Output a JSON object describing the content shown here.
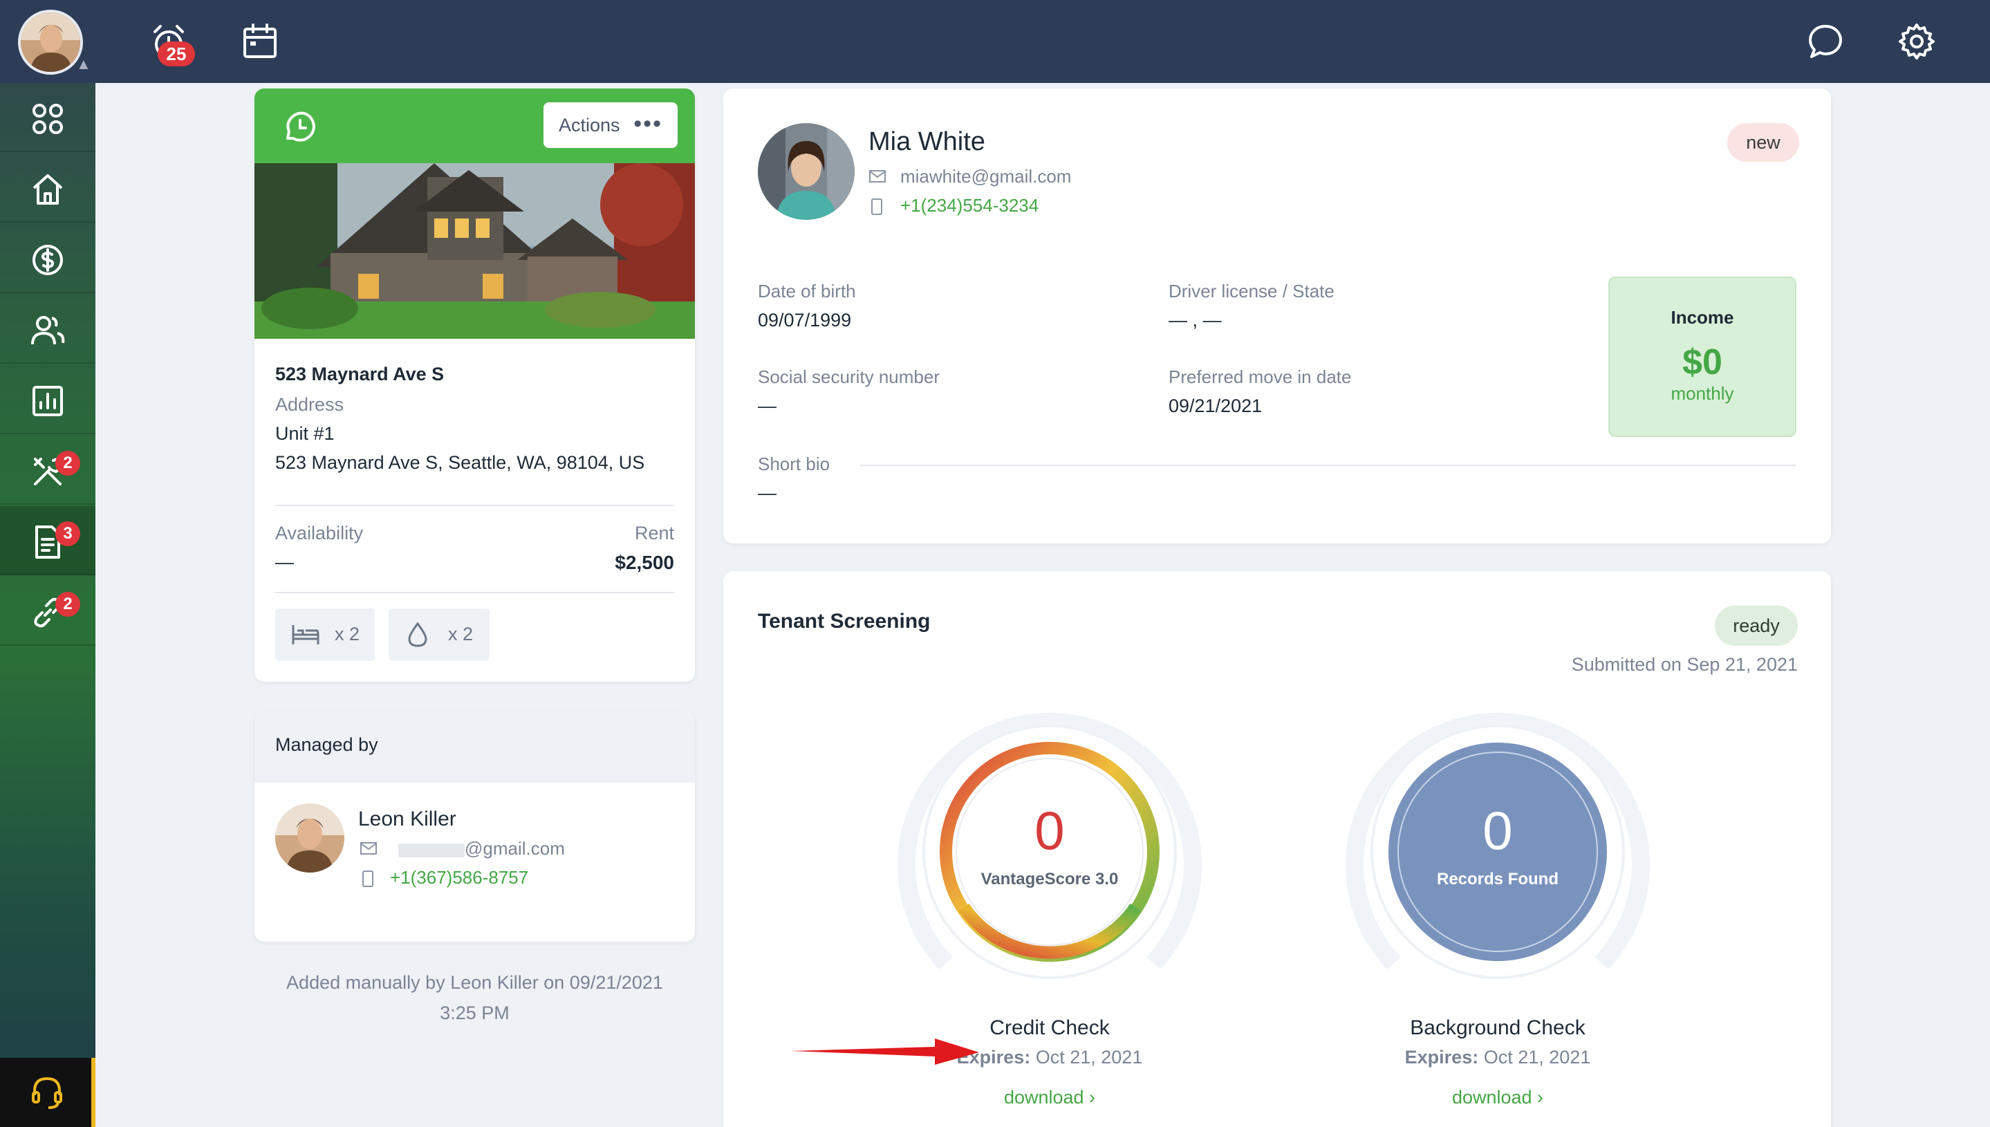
{
  "topbar": {
    "notifications_count": "25",
    "icons": [
      "alarm-clock-icon",
      "calendar-icon",
      "chat-bubble-icon",
      "gear-icon"
    ]
  },
  "sidebar": {
    "items": [
      {
        "icon": "grid-icon",
        "badge": ""
      },
      {
        "icon": "home-icon",
        "badge": ""
      },
      {
        "icon": "dollar-icon",
        "badge": ""
      },
      {
        "icon": "people-icon",
        "badge": ""
      },
      {
        "icon": "bar-chart-icon",
        "badge": ""
      },
      {
        "icon": "tools-icon",
        "badge": "2"
      },
      {
        "icon": "document-icon",
        "badge": "3",
        "active": true
      },
      {
        "icon": "link-icon",
        "badge": "2"
      }
    ],
    "support_icon": "headset-icon"
  },
  "property": {
    "actions_label": "Actions",
    "actions_more": "•••",
    "title": "523 Maynard Ave S",
    "address_label": "Address",
    "unit": "Unit #1",
    "full_address": "523 Maynard Ave S, Seattle, WA, 98104, US",
    "availability_label": "Availability",
    "availability_value": "—",
    "rent_label": "Rent",
    "rent_value": "$2,500",
    "beds": "x 2",
    "baths": "x 2"
  },
  "managed": {
    "heading": "Managed by",
    "name": "Leon Killer",
    "email": "@gmail.com",
    "phone": "+1(367)586-8757"
  },
  "added_note_line1": "Added manually by Leon Killer on 09/21/2021",
  "added_note_line2": "3:25 PM",
  "tenant": {
    "name": "Mia White",
    "email": "miawhite@gmail.com",
    "phone": "+1(234)554-3234",
    "status": "new",
    "dob_label": "Date of birth",
    "dob": "09/07/1999",
    "license_label": "Driver license / State",
    "license": "— , —",
    "ssn_label": "Social security number",
    "ssn": "—",
    "move_label": "Preferred move in date",
    "move": "09/21/2021",
    "bio_label": "Short bio",
    "bio": "—",
    "income_label": "Income",
    "income_value": "$0",
    "income_period": "monthly"
  },
  "screening": {
    "title": "Tenant Screening",
    "status": "ready",
    "submitted": "Submitted on Sep 21, 2021",
    "credit": {
      "score": "0",
      "score_label": "VantageScore 3.0",
      "title": "Credit Check",
      "expires_label": "Expires:",
      "expires": "Oct 21, 2021",
      "download": "download ›"
    },
    "background": {
      "count": "0",
      "count_label": "Records Found",
      "title": "Background Check",
      "expires_label": "Expires:",
      "expires": "Oct 21, 2021",
      "download": "download ›"
    }
  },
  "colors": {
    "topbar": "#2e3d57",
    "accent_green": "#4cb749",
    "badge_red": "#e0353b",
    "background_gauge": "#7a93bd",
    "arrow": "#e0191d"
  }
}
